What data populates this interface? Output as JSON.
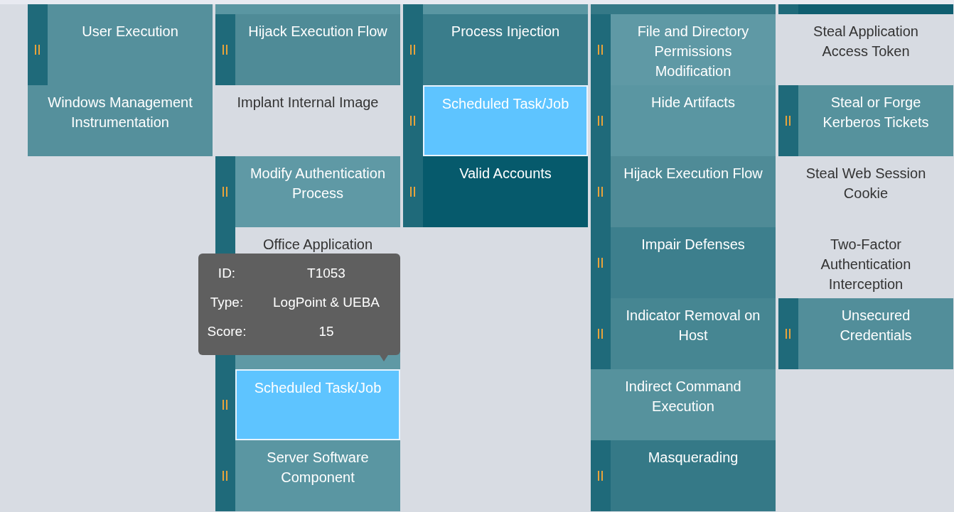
{
  "columns": [
    {
      "cells": [
        {
          "kind": "clipped",
          "color": "#55909c",
          "sub": true,
          "scored": true,
          "highlighted": false
        },
        {
          "kind": "technique",
          "name": "User Execution",
          "color": "#55909c",
          "sub": true,
          "scored": true,
          "highlighted": false
        },
        {
          "kind": "technique",
          "name": "Windows Management Instrumentation",
          "color": "#55909c",
          "sub": false,
          "scored": true,
          "highlighted": false
        }
      ]
    },
    {
      "cells": [
        {
          "kind": "clipped",
          "color": "#5a96a2",
          "sub": false,
          "scored": true,
          "highlighted": false
        },
        {
          "kind": "technique",
          "name": "Hijack Execution Flow",
          "color": "#4f8b97",
          "sub": true,
          "scored": true,
          "highlighted": false
        },
        {
          "kind": "technique",
          "name": "Implant Internal Image",
          "sub": false,
          "scored": false,
          "highlighted": false
        },
        {
          "kind": "technique",
          "name": "Modify Authentication Process",
          "color": "#5f99a5",
          "sub": true,
          "scored": true,
          "highlighted": false
        },
        {
          "kind": "technique",
          "name": "Office Application",
          "sub": true,
          "handle_covered": true,
          "scored": false,
          "highlighted": false
        },
        {
          "kind": "technique",
          "color": "#5f99a5",
          "sub": true,
          "handle_covered": true,
          "scored": true,
          "highlighted": false
        },
        {
          "kind": "technique",
          "name": "Scheduled Task/Job",
          "sub": true,
          "scored": true,
          "highlighted": true
        },
        {
          "kind": "technique",
          "name": "Server Software Component",
          "color": "#5a96a2",
          "sub": true,
          "scored": true,
          "highlighted": false
        }
      ]
    },
    {
      "cells": [
        {
          "kind": "clipped",
          "color": "#5a96a2",
          "sub": true,
          "scored": true,
          "highlighted": false
        },
        {
          "kind": "technique",
          "name": "Process Injection",
          "color": "#3a7d8b",
          "sub": true,
          "scored": true,
          "highlighted": false
        },
        {
          "kind": "technique",
          "name": "Scheduled Task/Job",
          "sub": true,
          "scored": true,
          "highlighted": true
        },
        {
          "kind": "technique",
          "name": "Valid Accounts",
          "color": "#065a6c",
          "sub": true,
          "scored": true,
          "highlighted": false
        }
      ]
    },
    {
      "cells": [
        {
          "kind": "clipped",
          "color": "#357987",
          "sub": false,
          "scored": true,
          "highlighted": false
        },
        {
          "kind": "technique",
          "name": "File and Directory Permissions Modification",
          "color": "#5f99a5",
          "sub": true,
          "scored": true,
          "highlighted": false
        },
        {
          "kind": "technique",
          "name": "Hide Artifacts",
          "color": "#5a96a2",
          "sub": true,
          "scored": true,
          "highlighted": false
        },
        {
          "kind": "technique",
          "name": "Hijack Execution Flow",
          "color": "#4f8b97",
          "sub": true,
          "scored": true,
          "highlighted": false
        },
        {
          "kind": "technique",
          "name": "Impair Defenses",
          "color": "#3d7f8d",
          "sub": true,
          "scored": true,
          "highlighted": false
        },
        {
          "kind": "technique",
          "name": "Indicator Removal on Host",
          "color": "#468692",
          "sub": true,
          "scored": true,
          "highlighted": false
        },
        {
          "kind": "technique",
          "name": "Indirect Command Execution",
          "color": "#56929d",
          "sub": false,
          "scored": true,
          "highlighted": false
        },
        {
          "kind": "technique",
          "name": "Masquerading",
          "color": "#357987",
          "sub": true,
          "scored": true,
          "highlighted": false
        }
      ]
    },
    {
      "cells": [
        {
          "kind": "clipped",
          "color": "#0f5e70",
          "sub": true,
          "scored": true,
          "highlighted": false
        },
        {
          "kind": "technique",
          "name": "Steal Application Access Token",
          "sub": false,
          "scored": false,
          "highlighted": false
        },
        {
          "kind": "technique",
          "name": "Steal or Forge Kerberos Tickets",
          "color": "#56929d",
          "sub": true,
          "scored": true,
          "highlighted": false
        },
        {
          "kind": "technique",
          "name": "Steal Web Session Cookie",
          "sub": false,
          "scored": false,
          "highlighted": false
        },
        {
          "kind": "technique",
          "name": "Two-Factor Authentication Interception",
          "sub": false,
          "scored": false,
          "highlighted": false
        },
        {
          "kind": "technique",
          "name": "Unsecured Credentials",
          "color": "#528e9a",
          "sub": true,
          "scored": true,
          "highlighted": false
        }
      ]
    }
  ],
  "tooltip": {
    "rows": [
      {
        "label": "ID:",
        "value": "T1053"
      },
      {
        "label": "Type:",
        "value": "LogPoint & UEBA"
      },
      {
        "label": "Score:",
        "value": "15"
      }
    ]
  }
}
